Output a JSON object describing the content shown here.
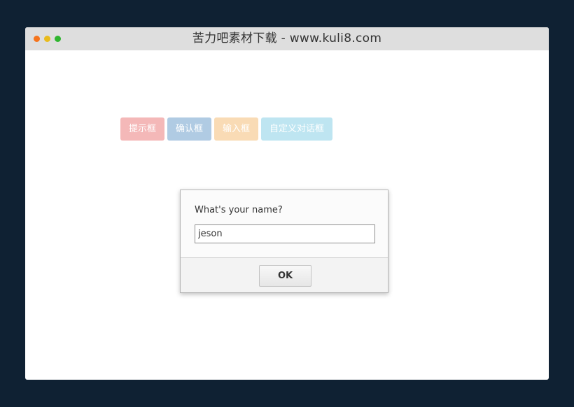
{
  "window": {
    "title": "苦力吧素材下载 - www.kuli8.com",
    "dot_colors": [
      "#f5741c",
      "#e9bb1c",
      "#2fb52f"
    ]
  },
  "demo_buttons": [
    {
      "label": "提示框",
      "color": "#f4b8b8"
    },
    {
      "label": "确认框",
      "color": "#b0cbe3"
    },
    {
      "label": "输入框",
      "color": "#f9dbb5"
    },
    {
      "label": "自定义对话框",
      "color": "#bee5f1"
    }
  ],
  "prompt_dialog": {
    "message": "What's your name?",
    "input_value": "jeson",
    "ok_label": "OK"
  }
}
